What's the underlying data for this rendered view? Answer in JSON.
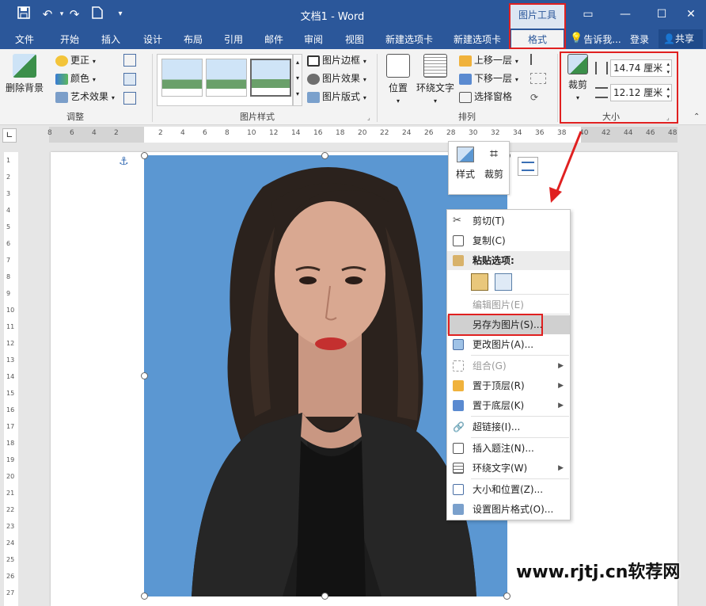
{
  "window": {
    "title": "文档1 - Word",
    "picture_tools_label": "图片工具"
  },
  "qat": {
    "save": "save-icon",
    "undo": "undo-icon",
    "redo": "redo-icon",
    "new": "new-doc-icon",
    "customize": "▾"
  },
  "window_buttons": {
    "ribbon_display": "▭",
    "minimize": "—",
    "maximize": "☐",
    "close": "✕"
  },
  "tabs": [
    "文件",
    "开始",
    "插入",
    "设计",
    "布局",
    "引用",
    "邮件",
    "审阅",
    "视图",
    "新建选项卡",
    "新建选项卡",
    "格式"
  ],
  "tellme": "告诉我...",
  "signin": "登录",
  "share": "共享",
  "ribbon": {
    "adjust": {
      "remove_bg": "删除背景",
      "correct": "更正",
      "color": "颜色",
      "artistic": "艺术效果",
      "label": "调整"
    },
    "styles": {
      "border": "图片边框",
      "effects": "图片效果",
      "layout": "图片版式",
      "label": "图片样式"
    },
    "arrange": {
      "position": "位置",
      "wrap": "环绕文字",
      "forward": "上移一层",
      "backward": "下移一层",
      "pane": "选择窗格",
      "label": "排列"
    },
    "size": {
      "crop": "裁剪",
      "height": "14.74 厘米",
      "width": "12.12 厘米",
      "label": "大小"
    }
  },
  "ruler": {
    "ticks": [
      "8",
      "6",
      "4",
      "2",
      "",
      "2",
      "4",
      "6",
      "8",
      "10",
      "12",
      "14",
      "16",
      "18",
      "20",
      "22",
      "24",
      "26",
      "28",
      "30",
      "32",
      "34",
      "36",
      "38",
      "40",
      "42",
      "44",
      "46",
      "48"
    ],
    "vticks": [
      "1",
      "2",
      "3",
      "4",
      "5",
      "6",
      "7",
      "8",
      "9",
      "10",
      "11",
      "12",
      "13",
      "14",
      "15",
      "16",
      "17",
      "18",
      "19",
      "20",
      "21",
      "22",
      "23",
      "24",
      "25",
      "26",
      "27"
    ]
  },
  "minitoolbar": {
    "style": "样式",
    "crop": "裁剪"
  },
  "context_menu": {
    "items": [
      {
        "label": "剪切(T)",
        "icon": "scissors-icon"
      },
      {
        "label": "复制(C)",
        "icon": "copy-icon"
      },
      {
        "label": "粘贴选项:",
        "icon": "paste-icon"
      },
      {
        "label": "编辑图片(E)",
        "icon": "",
        "disabled": true
      },
      {
        "label": "另存为图片(S)...",
        "icon": ""
      },
      {
        "label": "更改图片(A)...",
        "icon": "change-picture-icon"
      },
      {
        "label": "组合(G)",
        "icon": "group-icon",
        "disabled": true
      },
      {
        "label": "置于顶层(R)",
        "icon": "bring-front-icon"
      },
      {
        "label": "置于底层(K)",
        "icon": "send-back-icon"
      },
      {
        "label": "超链接(I)...",
        "icon": "link-icon"
      },
      {
        "label": "插入题注(N)...",
        "icon": "caption-icon"
      },
      {
        "label": "环绕文字(W)",
        "icon": "wrap-icon"
      },
      {
        "label": "大小和位置(Z)...",
        "icon": "size-position-icon"
      },
      {
        "label": "设置图片格式(O)...",
        "icon": "format-picture-icon"
      }
    ]
  },
  "watermark": "www.rjtj.cn软荐网"
}
